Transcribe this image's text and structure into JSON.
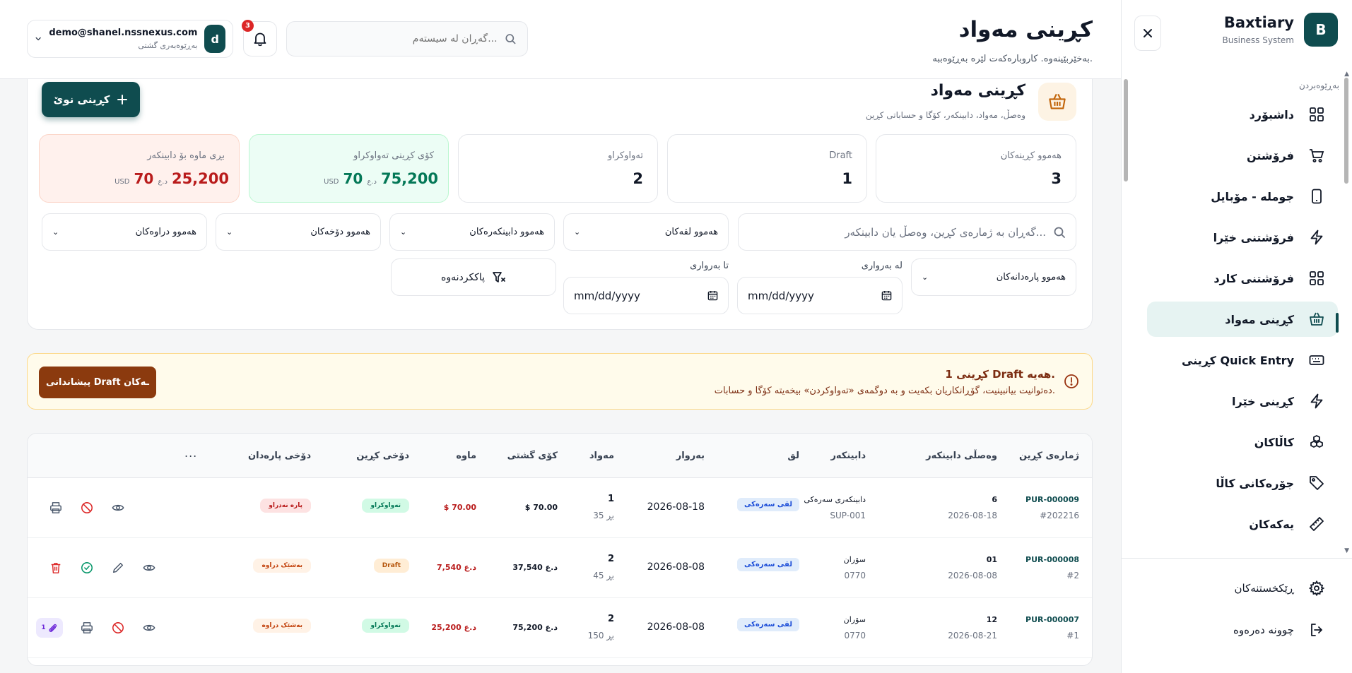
{
  "sidebar": {
    "brand_initial": "B",
    "brand_name": "Baxtiary",
    "brand_sub": "Business System",
    "section_label": "بەڕێوەبردن",
    "items": [
      {
        "label": "داشبۆرد",
        "icon": "dashboard-icon"
      },
      {
        "label": "فرۆشتن",
        "icon": "cart-icon"
      },
      {
        "label": "جوملە - مۆبایل",
        "icon": "mobile-icon"
      },
      {
        "label": "فرۆشتنی خێرا",
        "icon": "bolt-icon"
      },
      {
        "label": "فرۆشتنی کارد",
        "icon": "grid-icon"
      },
      {
        "label": "کڕینی مەواد",
        "icon": "basket-icon",
        "active": true
      },
      {
        "label": "کڕینی Quick Entry",
        "icon": "keyboard-icon"
      },
      {
        "label": "کڕینی خێرا",
        "icon": "bolt-icon"
      },
      {
        "label": "کاڵاکان",
        "icon": "boxes-icon"
      },
      {
        "label": "جۆرەکانی کاڵا",
        "icon": "tag-icon"
      },
      {
        "label": "یەکەکان",
        "icon": "ruler-icon"
      }
    ],
    "settings_label": "ڕێکخستنەکان",
    "logout_label": "چوونە دەرەوە"
  },
  "header": {
    "title": "کڕینی مەواد",
    "subtitle": "بەخێربێینەوە. کاروبارەکەت لێرە بەڕێوەببە.",
    "search_placeholder": "گەڕان لە سیستەم...",
    "notifications_count": "3",
    "user_initial": "d",
    "user_email": "demo@shanel.nssnexus.com",
    "user_role": "بەڕێوەبەری گشتی"
  },
  "section": {
    "title": "کڕینی مەواد",
    "subtitle": "وەصڵ، مەواد، دابینکەر، کۆگا و حساباتی کڕین",
    "new_button": "کڕینی نوێ"
  },
  "stats": {
    "total_label": "هەموو کڕینەکان",
    "total_value": "3",
    "draft_label": "Draft",
    "draft_value": "1",
    "completed_label": "تەواوکراو",
    "completed_value": "2",
    "completed_total_label": "کۆی کڕینی تەواوکراو",
    "completed_total_iqd": "75,200",
    "completed_total_usd": "70",
    "remaining_label": "بڕی ماوە بۆ دابینکەر",
    "remaining_iqd": "25,200",
    "remaining_usd": "70",
    "iqd_symbol": "د.ع",
    "usd_symbol": "USD"
  },
  "filters": {
    "search_placeholder": "گەڕان بە ژمارەی کڕین، وەصڵ یان دابینکەر...",
    "branches": "هەموو لقەکان",
    "vendors": "هەموو دابینکەرەکان",
    "statuses": "هەموو دۆخەکان",
    "currencies": "هەموو دراوەکان",
    "payments": "هەموو پارەدانەکان",
    "from_label": "لە بەرواری",
    "to_label": "تا بەرواری",
    "date_placeholder": "mm/dd/yyyy",
    "clear": "پاککردنەوە"
  },
  "alert": {
    "title": "1 کڕینی Draft هەیە.",
    "text": "دەتوانیت بیانبینیت، گۆڕانکاریان بکەیت و بە دوگمەی «تەواوکردن» بیخەیتە کۆگا و حسابات.",
    "button": "پیشاندانی Draft ـەکان"
  },
  "table": {
    "headers": {
      "number": "ژمارەی کڕین",
      "vendor_ref": "وەصڵی دابینکەر",
      "vendor": "دابینکەر",
      "branch": "لق",
      "date": "بەروار",
      "items": "مەواد",
      "total": "کۆی گشتی",
      "remaining": "ماوە",
      "status": "دۆخی کڕین",
      "payment": "دۆخی پارەدان",
      "more": "..."
    },
    "rows": [
      {
        "number": "PUR-000009",
        "ref": "#202216",
        "vendor_ref": "6",
        "vendor_date": "2026-08-18",
        "vendor": "دابینکەری سەرەکی",
        "vendor_code": "SUP-001",
        "branch": "لقی سەرەکی",
        "date": "2026-08-18",
        "items": "1",
        "items_sub": "35 بڕ",
        "total": "70.00",
        "total_cur": "$",
        "remaining": "70.00",
        "remaining_cur": "$",
        "status": "تەواوکراو",
        "payment": "پارە نەدراو"
      },
      {
        "number": "PUR-000008",
        "ref": "#2",
        "vendor_ref": "01",
        "vendor_date": "2026-08-08",
        "vendor": "سۆران",
        "vendor_code": "0770",
        "branch": "لقی سەرەکی",
        "date": "2026-08-08",
        "items": "2",
        "items_sub": "45 بڕ",
        "total": "37,540",
        "total_cur": "د.ع",
        "remaining": "7,540",
        "remaining_cur": "د.ع",
        "status": "Draft",
        "payment": "بەشێک دراوە"
      },
      {
        "number": "PUR-000007",
        "ref": "#1",
        "vendor_ref": "12",
        "vendor_date": "2026-08-21",
        "vendor": "سۆران",
        "vendor_code": "0770",
        "branch": "لقی سەرەکی",
        "date": "2026-08-08",
        "items": "2",
        "items_sub": "150 بڕ",
        "total": "75,200",
        "total_cur": "د.ع",
        "remaining": "25,200",
        "remaining_cur": "د.ع",
        "status": "تەواوکراو",
        "payment": "بەشێک دراوە",
        "attachments": "1"
      }
    ]
  },
  "colors": {
    "brand": "#0f4c4f",
    "active_bg": "#e6f3f2",
    "alert_bg": "#fffbeb",
    "alert_btn": "#8b3a0e",
    "danger": "#b91c1c",
    "success": "#047857"
  }
}
